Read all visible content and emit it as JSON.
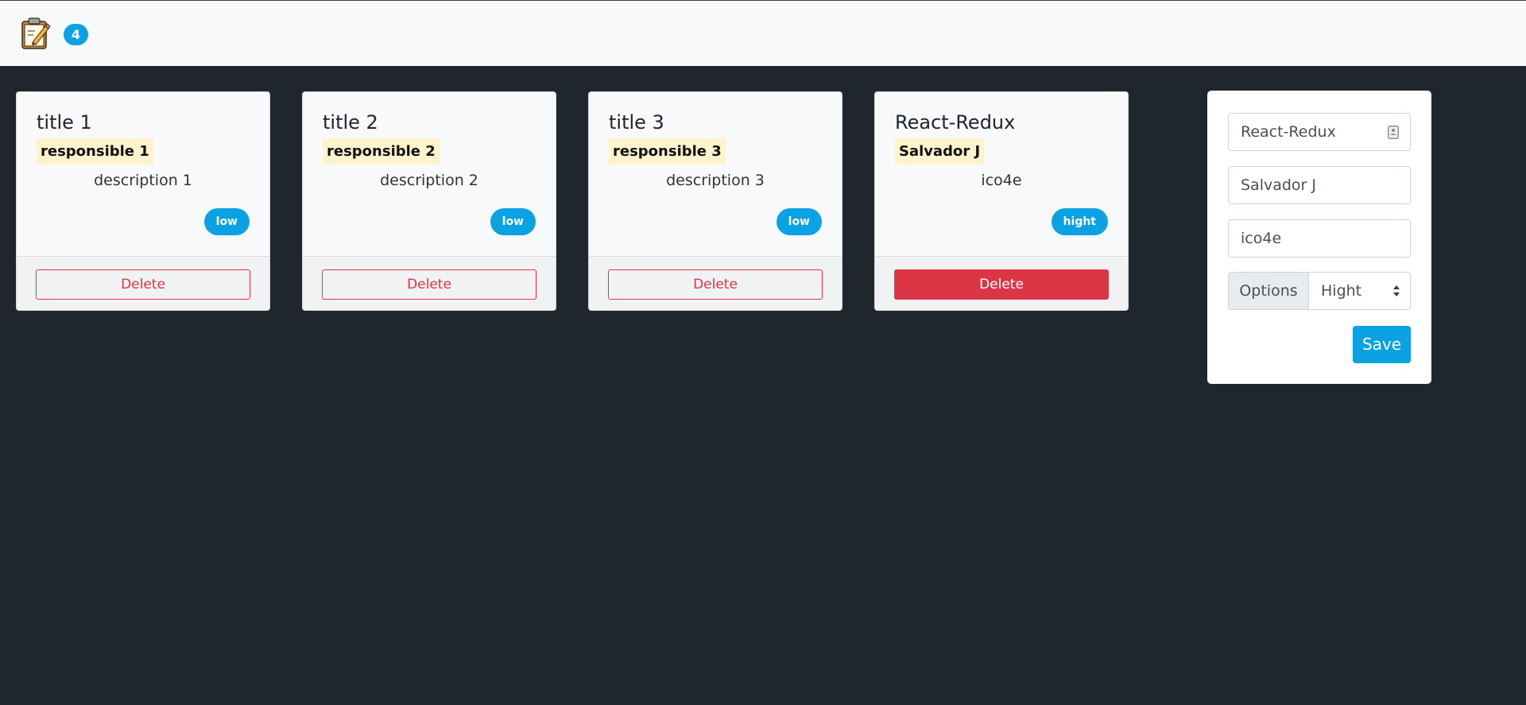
{
  "navbar": {
    "brand_icon": "clipboard-pencil-icon",
    "task_count": "4"
  },
  "tasks": [
    {
      "title": "title 1",
      "responsible": "responsible 1",
      "description": "description 1",
      "priority": "low",
      "delete_label": "Delete"
    },
    {
      "title": "title 2",
      "responsible": "responsible 2",
      "description": "description 2",
      "priority": "low",
      "delete_label": "Delete"
    },
    {
      "title": "title 3",
      "responsible": "responsible 3",
      "description": "description 3",
      "priority": "low",
      "delete_label": "Delete"
    },
    {
      "title": "React-Redux",
      "responsible": "Salvador J",
      "description": "ico4e",
      "priority": "hight",
      "delete_label": "Delete"
    }
  ],
  "form": {
    "title_value": "React-Redux",
    "title_icon": "contact-card-icon",
    "responsible_value": "Salvador J",
    "description_value": "ico4e",
    "options_label": "Options",
    "priority_selected": "Hight",
    "save_label": "Save"
  },
  "colors": {
    "background": "#20262e",
    "accent": "#0aa2e2",
    "danger": "#dc3545",
    "highlight": "#fff3cd"
  }
}
